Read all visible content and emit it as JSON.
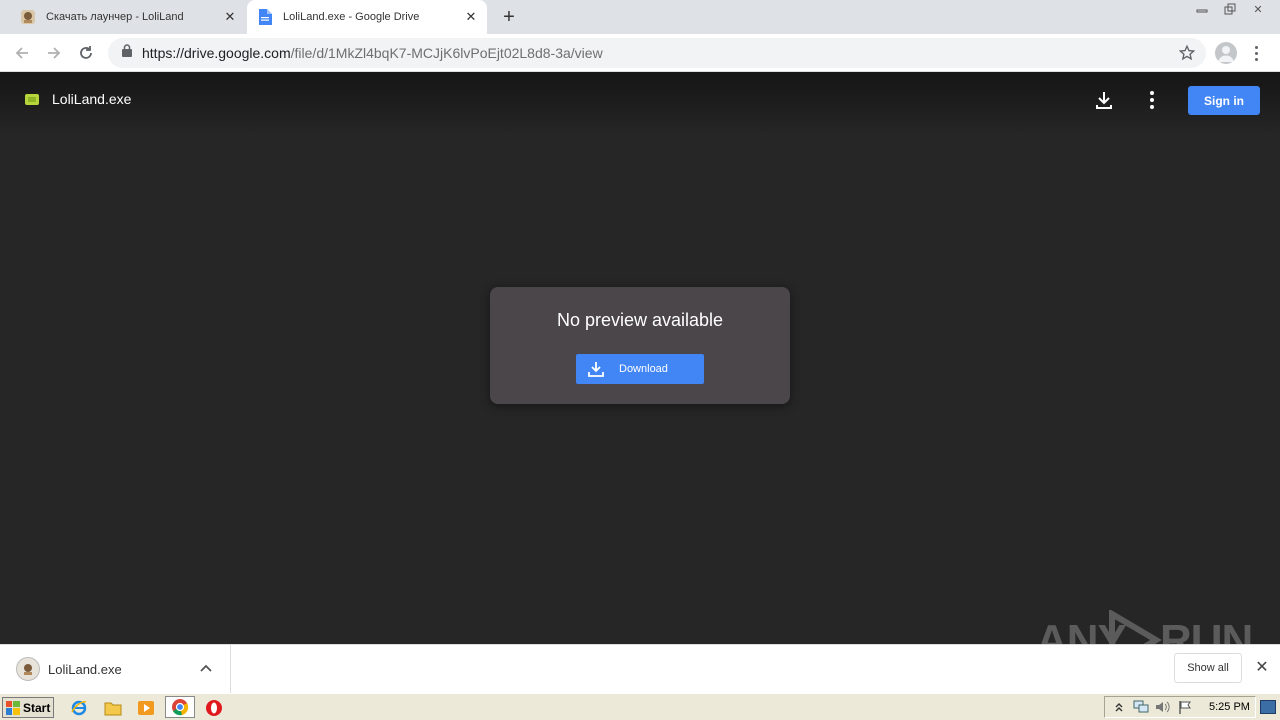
{
  "browser": {
    "tabs": [
      {
        "title": "Скачать лаунчер - LoliLand",
        "active": false
      },
      {
        "title": "LoliLand.exe - Google Drive",
        "active": true
      }
    ],
    "new_tab_label": "+",
    "window_controls": [
      "minimize",
      "restore",
      "close"
    ],
    "url_host": "https://drive.google.com",
    "url_path": "/file/d/1MkZl4bqK7-MCJjK6lvPoEjt02L8d8-3a/view"
  },
  "drive": {
    "file_name": "LoliLand.exe",
    "sign_in_label": "Sign in",
    "accent_color": "#4285f4",
    "preview": {
      "message": "No preview available",
      "download_label": "Download"
    }
  },
  "watermark": {
    "text_left": "ANY",
    "text_right": "RUN"
  },
  "download_shelf": {
    "item_name": "LoliLand.exe",
    "show_all_label": "Show all",
    "close_glyph": "✕"
  },
  "taskbar": {
    "start_label": "Start",
    "pinned_icons": [
      "internet-explorer-icon",
      "folder-icon",
      "media-player-icon",
      "chrome-icon",
      "opera-icon"
    ],
    "clock": "5:25 PM"
  }
}
